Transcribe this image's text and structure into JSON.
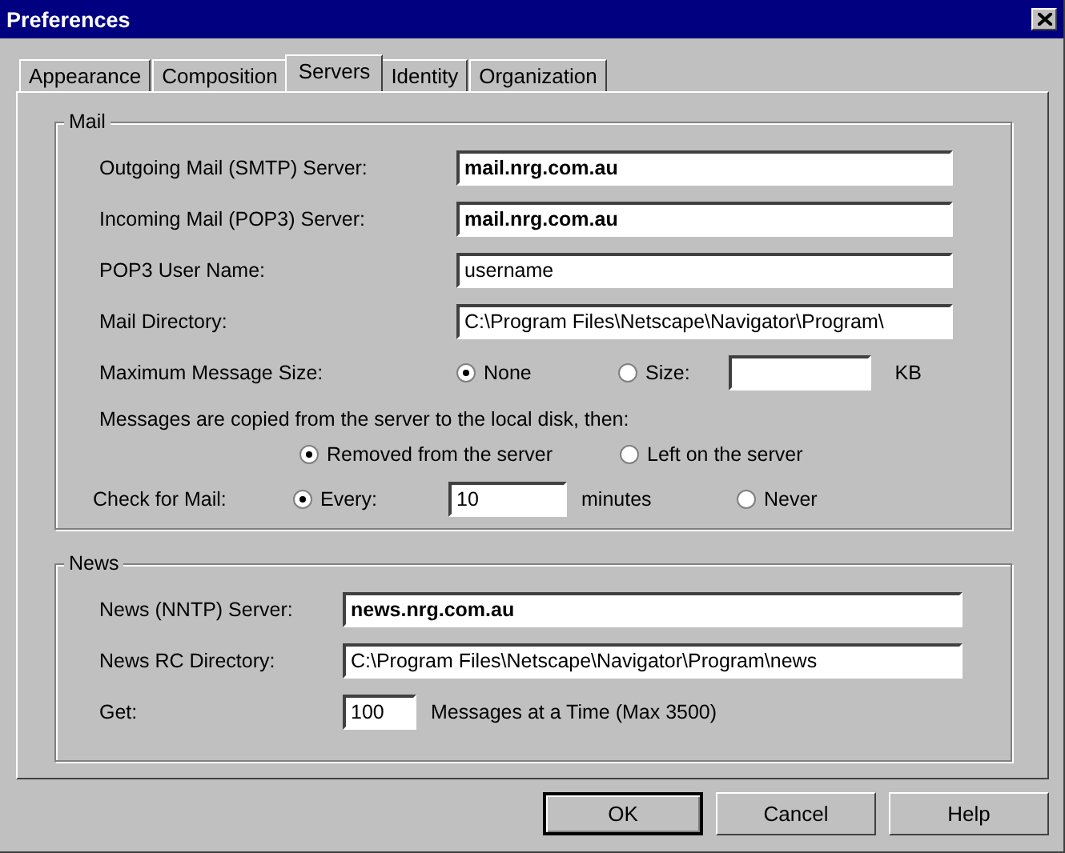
{
  "window": {
    "title": "Preferences"
  },
  "tabs": [
    {
      "label": "Appearance",
      "selected": false
    },
    {
      "label": "Composition",
      "selected": false
    },
    {
      "label": "Servers",
      "selected": true
    },
    {
      "label": "Identity",
      "selected": false
    },
    {
      "label": "Organization",
      "selected": false
    }
  ],
  "mail": {
    "legend": "Mail",
    "fields": [
      {
        "label": "Outgoing Mail (SMTP) Server:",
        "value": "mail.nrg.com.au",
        "bold": true
      },
      {
        "label": "Incoming Mail (POP3) Server:",
        "value": "mail.nrg.com.au",
        "bold": true
      },
      {
        "label": "POP3 User Name:",
        "value": "username",
        "bold": false
      },
      {
        "label": "Mail Directory:",
        "value": "C:\\Program Files\\Netscape\\Navigator\\Program\\",
        "bold": false
      }
    ],
    "max_size": {
      "label": "Maximum Message Size:",
      "options": [
        {
          "label": "None",
          "selected": true
        },
        {
          "label": "Size:",
          "selected": false
        }
      ],
      "unit": "KB"
    },
    "copy_note": "Messages are copied from the server to the local disk, then:",
    "copy_options": [
      {
        "label": "Removed from the server",
        "selected": true
      },
      {
        "label": "Left on the server",
        "selected": false
      }
    ],
    "check": {
      "label": "Check for Mail:",
      "every": {
        "label": "Every:",
        "selected": true
      },
      "minutes": "10",
      "unit": "minutes",
      "never": {
        "label": "Never",
        "selected": false
      }
    }
  },
  "news": {
    "legend": "News",
    "fields": [
      {
        "label": "News (NNTP) Server:",
        "value": "news.nrg.com.au",
        "bold": true
      },
      {
        "label": "News RC Directory:",
        "value": "C:\\Program Files\\Netscape\\Navigator\\Program\\news",
        "bold": false
      }
    ],
    "get": {
      "label": "Get:",
      "value": "100",
      "suffix": "Messages at a Time (Max 3500)"
    }
  },
  "buttons": [
    {
      "label": "OK",
      "default": true
    },
    {
      "label": "Cancel",
      "default": false
    },
    {
      "label": "Help",
      "default": false
    }
  ]
}
